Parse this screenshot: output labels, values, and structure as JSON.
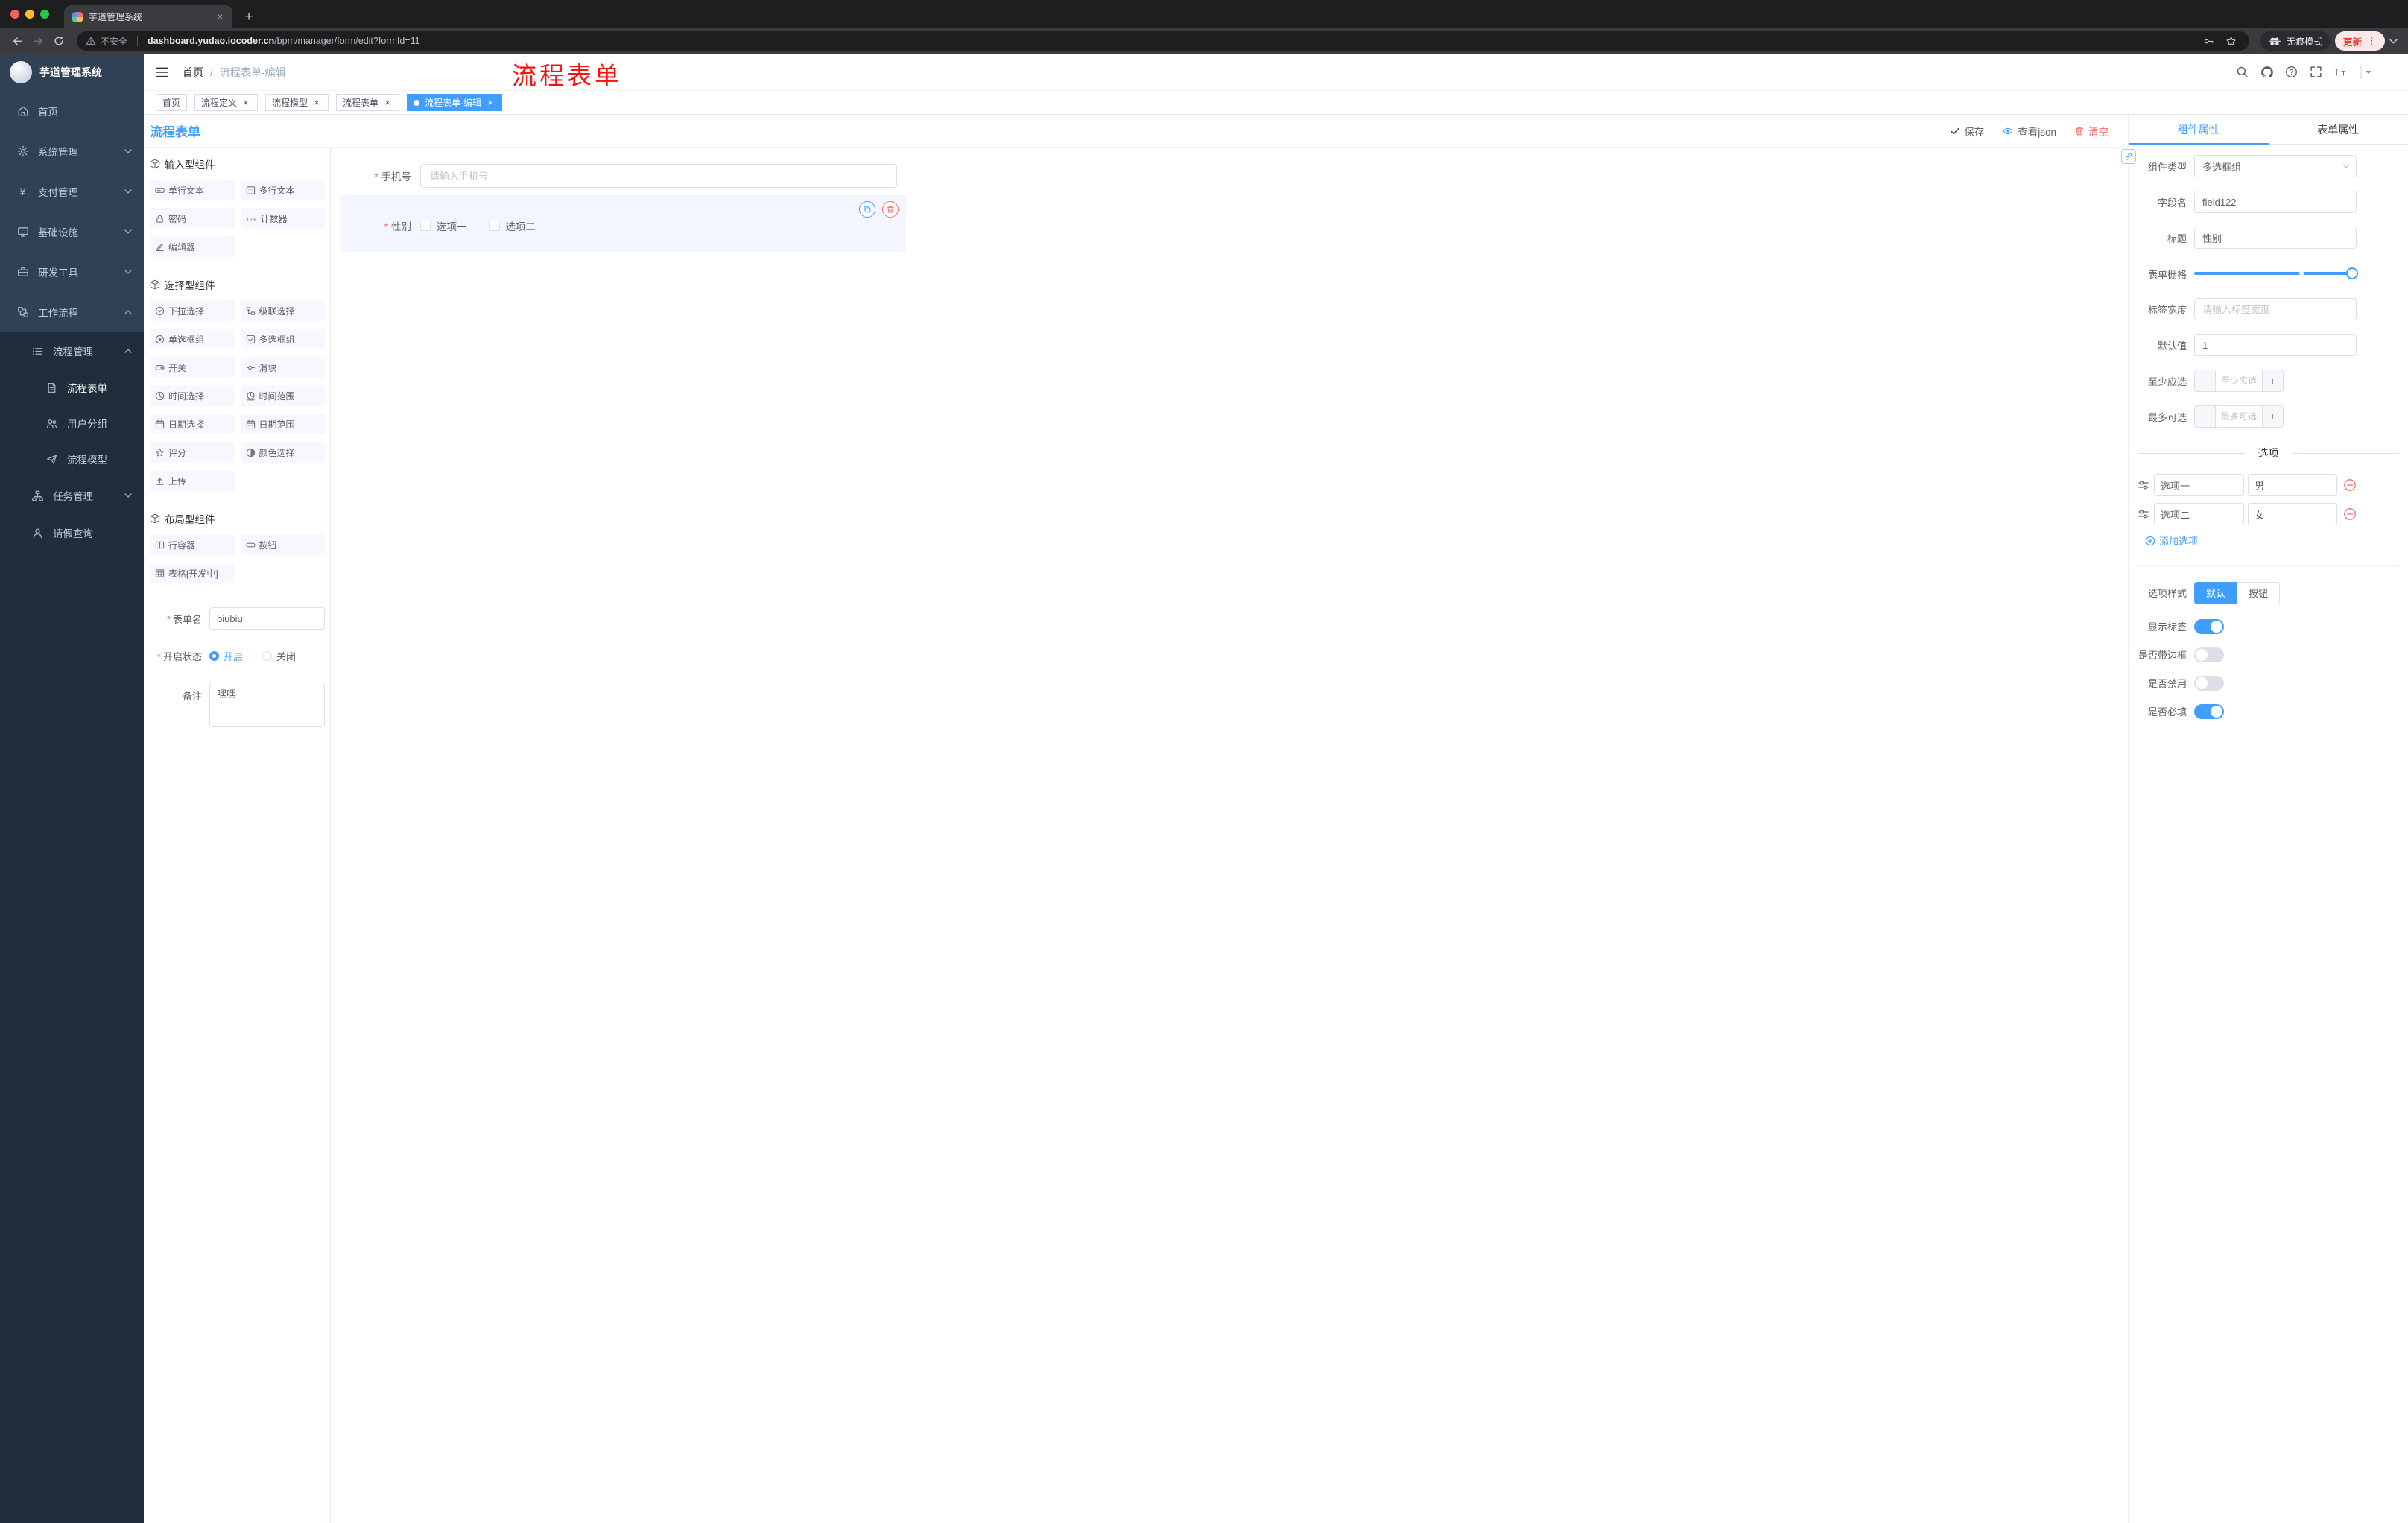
{
  "theme": {
    "accent": "#409eff",
    "danger": "#f56c6c",
    "annotation-red": "#fb0f0f",
    "sidebar-bg": "#304156",
    "sidebar-sub-bg": "#1f2d3d",
    "chrome-bg": "#1d1e20",
    "chrome-toolbar-bg": "#3a3b3e",
    "traffic-red": "#ff5f57",
    "traffic-yellow": "#febc2e",
    "traffic-green": "#28c840"
  },
  "browser": {
    "tab_title": "芋道管理系统",
    "address": {
      "security_label": "不安全",
      "domain": "dashboard.yudao.iocoder.cn",
      "path": "/bpm/manager/form/edit?formId=11"
    },
    "incognito_label": "无痕模式",
    "update_label": "更新",
    "menu_dots": "⋮",
    "close_tab": "×",
    "new_tab": "+"
  },
  "sidebar": {
    "logo_title": "芋道管理系统",
    "items": [
      {
        "label": "首页",
        "icon": "home"
      },
      {
        "label": "系统管理",
        "icon": "gear",
        "state": "collapsed"
      },
      {
        "label": "支付管理",
        "icon": "yen",
        "state": "collapsed"
      },
      {
        "label": "基础设施",
        "icon": "monitor",
        "state": "collapsed"
      },
      {
        "label": "研发工具",
        "icon": "briefcase",
        "state": "collapsed"
      },
      {
        "label": "工作流程",
        "icon": "workflow",
        "state": "expanded"
      },
      {
        "label": "流程管理",
        "icon": "list",
        "state": "expanded"
      },
      {
        "label": "流程表单",
        "icon": "document",
        "active": true
      },
      {
        "label": "用户分组",
        "icon": "users"
      },
      {
        "label": "流程模型",
        "icon": "send"
      },
      {
        "label": "任务管理",
        "icon": "tree",
        "state": "collapsed"
      },
      {
        "label": "请假查询",
        "icon": "user"
      }
    ]
  },
  "header": {
    "breadcrumb": {
      "home": "首页",
      "separator": "/",
      "current": "流程表单-编辑"
    },
    "annotation": "流程表单"
  },
  "tags": [
    {
      "label": "首页",
      "closable": false,
      "active": false
    },
    {
      "label": "流程定义",
      "closable": true,
      "active": false
    },
    {
      "label": "流程模型",
      "closable": true,
      "active": false
    },
    {
      "label": "流程表单",
      "closable": true,
      "active": false
    },
    {
      "label": "流程表单-编辑",
      "closable": true,
      "active": true
    }
  ],
  "designer": {
    "title": "流程表单",
    "toolbar": {
      "save": "保存",
      "view_json": "查看json",
      "clear": "清空"
    },
    "palette": {
      "sections": [
        {
          "title": "输入型组件",
          "items": [
            {
              "label": "单行文本"
            },
            {
              "label": "多行文本"
            },
            {
              "label": "密码"
            },
            {
              "label": "计数器"
            },
            {
              "label": "编辑器"
            }
          ]
        },
        {
          "title": "选择型组件",
          "items": [
            {
              "label": "下拉选择"
            },
            {
              "label": "级联选择"
            },
            {
              "label": "单选框组"
            },
            {
              "label": "多选框组"
            },
            {
              "label": "开关"
            },
            {
              "label": "滑块"
            },
            {
              "label": "时间选择"
            },
            {
              "label": "时间范围"
            },
            {
              "label": "日期选择"
            },
            {
              "label": "日期范围"
            },
            {
              "label": "评分"
            },
            {
              "label": "颜色选择"
            },
            {
              "label": "上传"
            }
          ]
        },
        {
          "title": "布局型组件",
          "items": [
            {
              "label": "行容器"
            },
            {
              "label": "按钮"
            },
            {
              "label": "表格[开发中]"
            }
          ]
        }
      ]
    },
    "form_meta": {
      "name_label": "表单名",
      "name_value": "biubiu",
      "status_label": "开启状态",
      "status_on": "开启",
      "status_off": "关闭",
      "status_value": "开启",
      "remark_label": "备注",
      "remark_value": "嘿嘿"
    },
    "canvas": {
      "phone_label": "手机号",
      "phone_placeholder": "请输入手机号",
      "gender_label": "性别",
      "gender_option1": "选项一",
      "gender_option2": "选项二",
      "gender_checked": []
    },
    "props": {
      "tab_component": "组件属性",
      "tab_form": "表单属性",
      "active_tab": "组件属性",
      "component_type_label": "组件类型",
      "component_type_value": "多选框组",
      "field_name_label": "字段名",
      "field_name_value": "field122",
      "title_label": "标题",
      "title_value": "性别",
      "grid_label": "表单栅格",
      "grid_slider": {
        "filled_percent": 100,
        "stop_percent": 66
      },
      "label_width_label": "标签宽度",
      "label_width_placeholder": "请输入标签宽度",
      "default_label": "默认值",
      "default_value": "1",
      "min_label": "至少应选",
      "min_placeholder": "至少应选",
      "max_label": "最多可选",
      "max_placeholder": "最多可选",
      "minus_sign": "−",
      "plus_sign": "+",
      "options_title": "选项",
      "options": [
        {
          "label": "选项一",
          "value": "男"
        },
        {
          "label": "选项二",
          "value": "女"
        }
      ],
      "add_option": "添加选项",
      "style_label": "选项样式",
      "style_default": "默认",
      "style_button": "按钮",
      "style_active": "默认",
      "toggles": [
        {
          "label": "显示标签",
          "on": true
        },
        {
          "label": "是否带边框",
          "on": false
        },
        {
          "label": "是否禁用",
          "on": false
        },
        {
          "label": "是否必填",
          "on": true
        }
      ]
    }
  }
}
